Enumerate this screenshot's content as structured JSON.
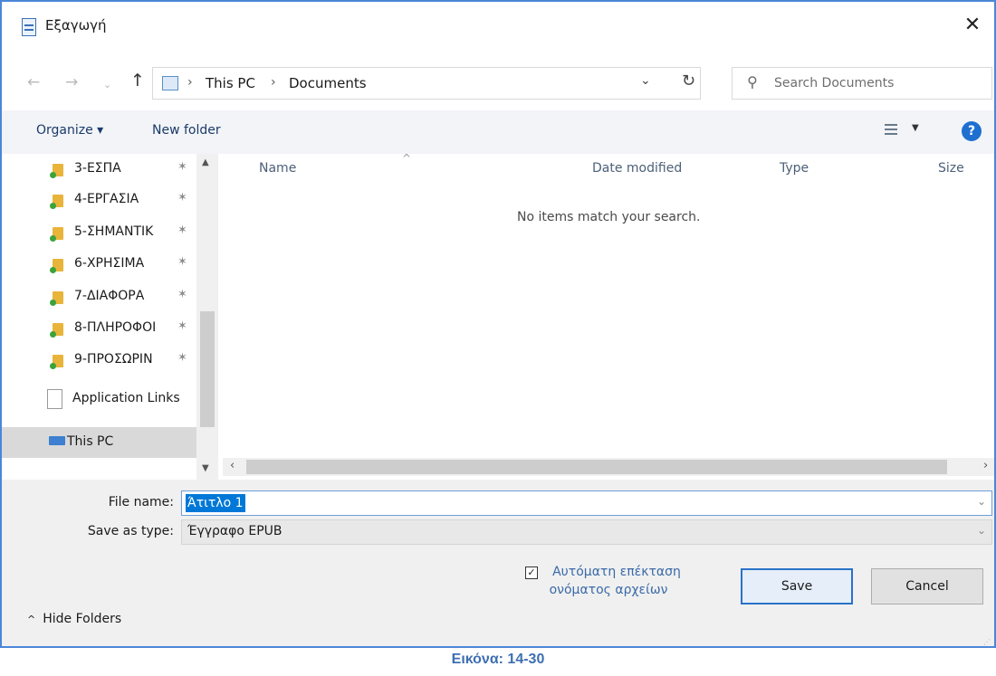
{
  "window": {
    "title": "Εξαγωγή"
  },
  "navigation": {
    "breadcrumbs": [
      "This PC",
      "Documents"
    ],
    "search_placeholder": "Search Documents"
  },
  "toolbar": {
    "organize_label": "Organize ▾",
    "new_folder_label": "New folder"
  },
  "sidebar": {
    "items": [
      {
        "label": "3-ΕΣΠΑ"
      },
      {
        "label": "4-ΕΡΓΑΣΙΑ"
      },
      {
        "label": "5-ΣΗΜΑΝΤΙΚ"
      },
      {
        "label": "6-ΧΡΗΣΙΜΑ"
      },
      {
        "label": "7-ΔΙΑΦΟΡΑ"
      },
      {
        "label": "8-ΠΛΗΡΟΦΟΙ"
      },
      {
        "label": "9-ΠΡΟΣΩΡΙΝ"
      }
    ],
    "application_links": "Application Links",
    "this_pc": "This PC"
  },
  "file_list": {
    "columns": [
      "Name",
      "Date modified",
      "Type",
      "Size"
    ],
    "empty_message": "No items match your search."
  },
  "form": {
    "file_name_label": "File name:",
    "file_name_value": "Άτιτλο 1",
    "save_type_label": "Save as type:",
    "save_type_value": "Έγγραφο EPUB"
  },
  "footer": {
    "hide_folders_label": "Hide Folders",
    "auto_extension_checked": true,
    "auto_extension_line1": "Αυτόματη επέκταση",
    "auto_extension_line2": "ονόματος αρχείων",
    "save_label": "Save",
    "cancel_label": "Cancel"
  },
  "caption": "Εικόνα: 14-30",
  "colors": {
    "accent": "#1e6fd0",
    "selection": "#0078d7",
    "caption": "#3d6fb0",
    "frame": "#4a86d8"
  }
}
